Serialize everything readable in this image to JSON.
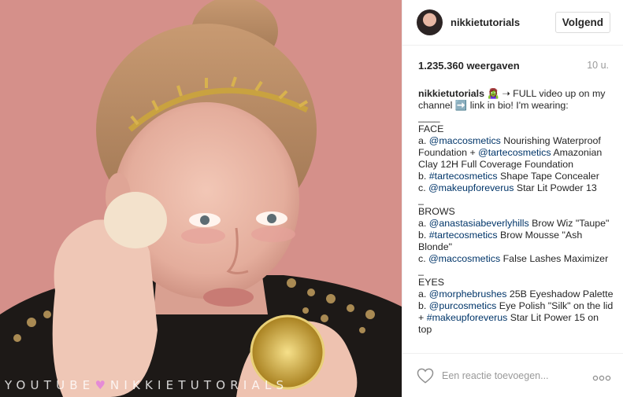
{
  "post": {
    "media": {
      "watermark_left": "YOUTUBE",
      "watermark_heart": "♥",
      "watermark_right": "NIKKIETUTORIALS"
    },
    "header": {
      "username": "nikkietutorials",
      "follow_label": "Volgend"
    },
    "stats": {
      "views": "1.235.360 weergaven",
      "time": "10 u."
    },
    "caption": {
      "author": "nikkietutorials",
      "segments": [
        {
          "t": "text",
          "v": " 🧟‍♀️ ➝ FULL video up on my channel ➡️ link in bio! I'm wearing:\n____\nFACE\na. "
        },
        {
          "t": "mention",
          "v": "@maccosmetics"
        },
        {
          "t": "text",
          "v": " Nourishing Waterproof Foundation + "
        },
        {
          "t": "mention",
          "v": "@tartecosmetics"
        },
        {
          "t": "text",
          "v": " Amazonian Clay 12H Full Coverage Foundation\nb. "
        },
        {
          "t": "mention",
          "v": "#tartecosmetics"
        },
        {
          "t": "text",
          "v": " Shape Tape Concealer\nc. "
        },
        {
          "t": "mention",
          "v": "@makeupforeverus"
        },
        {
          "t": "text",
          "v": " Star Lit Powder 13\n_\nBROWS\na. "
        },
        {
          "t": "mention",
          "v": "@anastasiabeverlyhills"
        },
        {
          "t": "text",
          "v": " Brow Wiz \"Taupe\"\nb. "
        },
        {
          "t": "mention",
          "v": "#tartecosmetics"
        },
        {
          "t": "text",
          "v": " Brow Mousse \"Ash Blonde\"\nc. "
        },
        {
          "t": "mention",
          "v": "@maccosmetics"
        },
        {
          "t": "text",
          "v": " False Lashes Maximizer\n_\nEYES\na. "
        },
        {
          "t": "mention",
          "v": "@morphebrushes"
        },
        {
          "t": "text",
          "v": " 25B Eyeshadow Palette\nb. "
        },
        {
          "t": "mention",
          "v": "@purcosmetics"
        },
        {
          "t": "text",
          "v": " Eye Polish \"Silk\" on the lid + "
        },
        {
          "t": "mention",
          "v": "#makeupforeverus"
        },
        {
          "t": "text",
          "v": " Star Lit Power 15 on top"
        }
      ]
    },
    "footer": {
      "like_icon": "heart-outline-icon",
      "comment_placeholder": "Een reactie toevoegen...",
      "more_icon": "more-options-icon"
    },
    "colors": {
      "link": "#003569",
      "muted": "#999999",
      "border": "#efefef"
    }
  }
}
